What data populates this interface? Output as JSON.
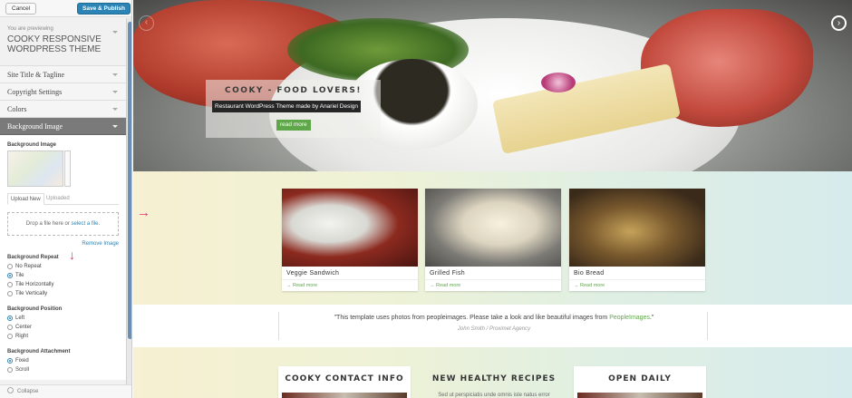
{
  "sidebar": {
    "cancel_label": "Cancel",
    "publish_label": "Save & Publish",
    "preview_label": "You are previewing",
    "theme_name": "COOKY RESPONSIVE WORDPRESS THEME",
    "sections": [
      {
        "label": "Site Title & Tagline"
      },
      {
        "label": "Copyright Settings"
      },
      {
        "label": "Colors"
      },
      {
        "label": "Background Image"
      }
    ],
    "background": {
      "image_title": "Background Image",
      "tab_upload": "Upload New",
      "tab_uploaded": "Uploaded",
      "drop_text": "Drop a file here or",
      "drop_link": "select a file.",
      "remove_label": "Remove Image",
      "repeat_title": "Background Repeat",
      "repeat_options": [
        "No Repeat",
        "Tile",
        "Tile Horizontally",
        "Tile Vertically"
      ],
      "repeat_selected": "Tile",
      "position_title": "Background Position",
      "position_options": [
        "Left",
        "Center",
        "Right"
      ],
      "position_selected": "Left",
      "attachment_title": "Background Attachment",
      "attachment_options": [
        "Fixed",
        "Scroll"
      ],
      "attachment_selected": "Fixed"
    },
    "collapse_label": "Collapse"
  },
  "icons": {
    "arrow_down": "↓",
    "arrow_right": "→",
    "nav_prev": "‹",
    "nav_next": "›"
  },
  "hero": {
    "title": "COOKY - FOOD LOVERS!",
    "subtitle": "Restaurant WordPress Theme made by Anariel Design",
    "button_label": "read more"
  },
  "cards": [
    {
      "title": "Veggie Sandwich",
      "more": "→ Read more"
    },
    {
      "title": "Grilled Fish",
      "more": "→ Read more"
    },
    {
      "title": "Bio Bread",
      "more": "→ Read more"
    }
  ],
  "quote": {
    "text": "\"This template uses photos from peopleimages. Please take a look and like beautiful images from",
    "link": "PeopleImages",
    "end": ".\"",
    "author": "John Smith / Proximet Agency"
  },
  "bottom_boxes": [
    {
      "title": "COOKY CONTACT INFO"
    },
    {
      "title": "NEW HEALTHY RECIPES",
      "text": "Sed ut perspiciatis unde omnis iste natus error"
    },
    {
      "title": "OPEN DAILY"
    }
  ],
  "colors": {
    "accent_green": "#5fa84a",
    "publish_blue": "#2b84b5",
    "annotation_pink": "#e2336e"
  }
}
